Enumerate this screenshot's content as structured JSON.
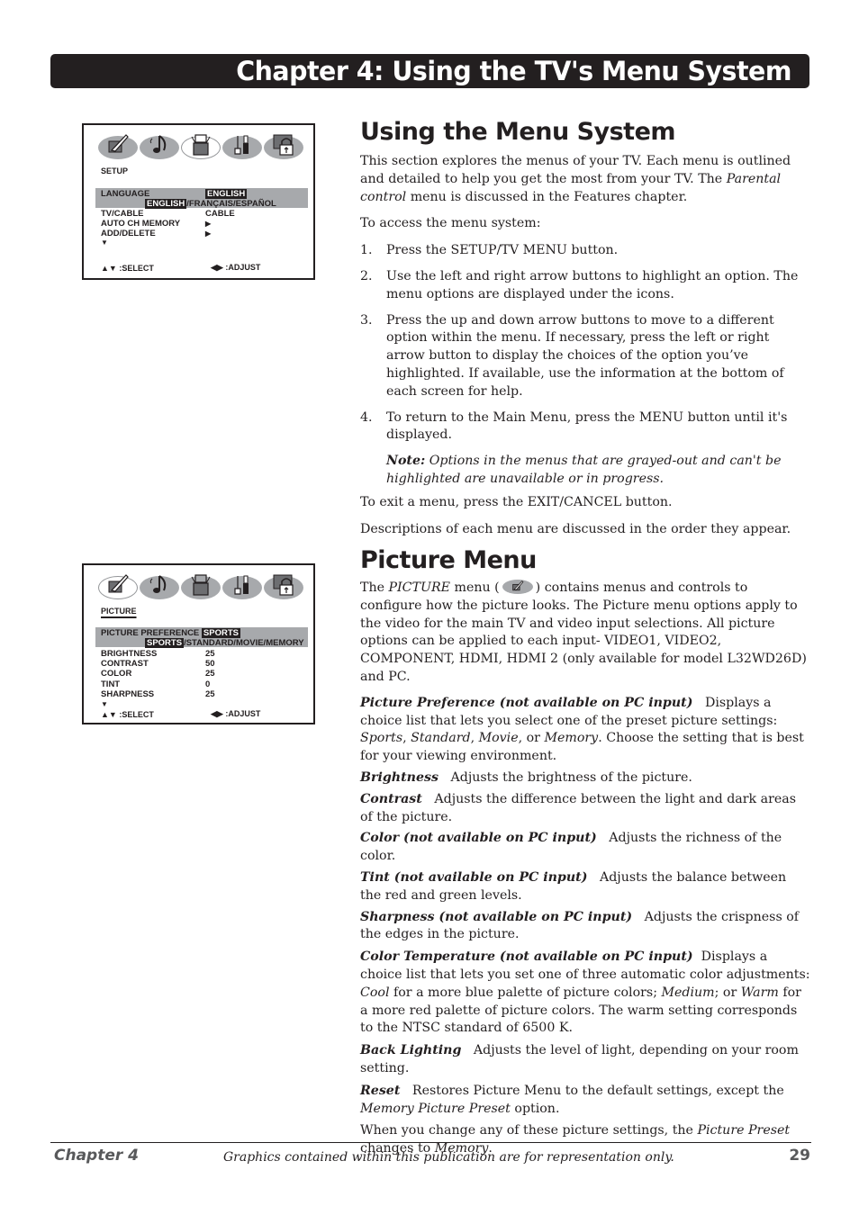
{
  "banner": {
    "title": "Chapter 4: Using the TV's Menu System"
  },
  "osd_icons": [
    {
      "name": "picture-icon"
    },
    {
      "name": "sound-icon"
    },
    {
      "name": "setup-icon"
    },
    {
      "name": "features-icon"
    },
    {
      "name": "parental-lock-icon"
    }
  ],
  "setup_screen": {
    "heading": "SETUP",
    "highlight": {
      "label": "LANGUAGE",
      "value": "ENGLISH",
      "choice_selected": "ENGLISH",
      "choice_rest": "/FRANÇAIS/ESPAÑOL"
    },
    "rows": [
      {
        "label": "TV/CABLE",
        "value": "CABLE"
      },
      {
        "label": "AUTO CH MEMORY",
        "value": "▶"
      },
      {
        "label": "ADD/DELETE",
        "value": "▶"
      }
    ],
    "more": "▼",
    "hint_select": "▲▼ :SELECT",
    "hint_adjust": "◀▶ :ADJUST"
  },
  "picture_screen": {
    "heading": "PICTURE",
    "highlight": {
      "label": "PICTURE PREFERENCE",
      "value": "SPORTS",
      "choice_selected": "SPORTS",
      "choice_rest": "/STANDARD/MOVIE/MEMORY"
    },
    "rows": [
      {
        "label": "BRIGHTNESS",
        "value": "25"
      },
      {
        "label": "CONTRAST",
        "value": "50"
      },
      {
        "label": "COLOR",
        "value": "25"
      },
      {
        "label": "TINT",
        "value": "0"
      },
      {
        "label": "SHARPNESS",
        "value": "25"
      }
    ],
    "more": "▼",
    "hint_select": "▲▼ :SELECT",
    "hint_adjust": "◀▶ :ADJUST"
  },
  "section1": {
    "title": "Using the Menu System",
    "intro_a": "This section explores the menus of your TV. Each menu is outlined and detailed to help you get the most from your TV. The ",
    "intro_em": "Parental control",
    "intro_b": " menu is discussed in the Features chapter.",
    "access": "To access the menu system:",
    "steps": [
      {
        "num": "1.",
        "text": "Press the SETUP/TV MENU button."
      },
      {
        "num": "2.",
        "text": "Use the left and right arrow buttons to highlight an option. The menu options are displayed under the icons."
      },
      {
        "num": "3.",
        "text": "Press the up and down arrow buttons to move to a different option within the menu. If necessary, press the left or right arrow button to display the choices of the option you’ve highlighted. If available, use the information at the bottom of each screen for help."
      },
      {
        "num": "4.",
        "text": "To return to the Main Menu, press the MENU button until it's displayed."
      }
    ],
    "note_label": "Note:",
    "note_text": " Options in the menus that are grayed-out and can't be highlighted are unavailable or in progress.",
    "exit": "To exit a menu, press the EXIT/CANCEL button.",
    "order": "Descriptions of each menu are discussed in the order they appear."
  },
  "section2": {
    "title": "Picture Menu",
    "intro_a": "The ",
    "intro_em": "PICTURE",
    "intro_b": " menu (",
    "intro_c": ") contains menus and controls to configure how the picture looks. The Picture menu options apply to the video for the main TV and video input selections. All picture options can be applied to each input- VIDEO1, VIDEO2, COMPONENT, HDMI, HDMI 2 (only available for model L32WD26D) and PC.",
    "pref_term": "Picture Preference (not available on PC input)",
    "pref_a": "   Displays a choice list that lets you select one of the preset picture settings: ",
    "pref_sports": "Sports",
    "pref_sep1": ", ",
    "pref_standard": "Standard",
    "pref_sep2": ", ",
    "pref_movie": "Movie",
    "pref_sep3": ", or ",
    "pref_memory": "Memory",
    "pref_b": ". Choose the setting that is best for your viewing environment.",
    "items": [
      {
        "term": "Brightness",
        "desc": "   Adjusts the brightness of the picture."
      },
      {
        "term": "Contrast",
        "desc": "   Adjusts the difference between the light and dark areas of the picture."
      },
      {
        "term": "Color (not available on PC input)",
        "desc": "   Adjusts the richness of the color."
      },
      {
        "term": "Tint (not available on PC input)",
        "desc": "   Adjusts the balance between the red and green levels."
      },
      {
        "term": "Sharpness (not available on PC input)",
        "desc": "   Adjusts the crispness of the edges in the picture."
      }
    ],
    "ct_term": "Color Temperature (not available on PC input)",
    "ct_a": "  Displays a choice list that lets you set one of three automatic color adjustments: ",
    "ct_cool": "Cool",
    "ct_b": " for a more blue palette of picture colors; ",
    "ct_medium": "Medium",
    "ct_c": "; or ",
    "ct_warm": "Warm",
    "ct_d": " for a more red palette of picture colors. The warm setting corresponds to the NTSC standard of 6500 K.",
    "bl_term": "Back Lighting",
    "bl_desc": "   Adjusts the level of light, depending on your room setting.",
    "reset_term": "Reset",
    "reset_a": "   Restores Picture Menu to the default settings, except the ",
    "reset_em": "Memory Picture Preset",
    "reset_b": " option.",
    "closing_a": "When you change any of these picture settings, the ",
    "closing_em1": "Picture Preset",
    "closing_b": " changes to ",
    "closing_em2": "Memory",
    "closing_c": "."
  },
  "footer": {
    "chapter": "Chapter 4",
    "note": "Graphics contained within this publication are for representation only.",
    "page": "29"
  }
}
